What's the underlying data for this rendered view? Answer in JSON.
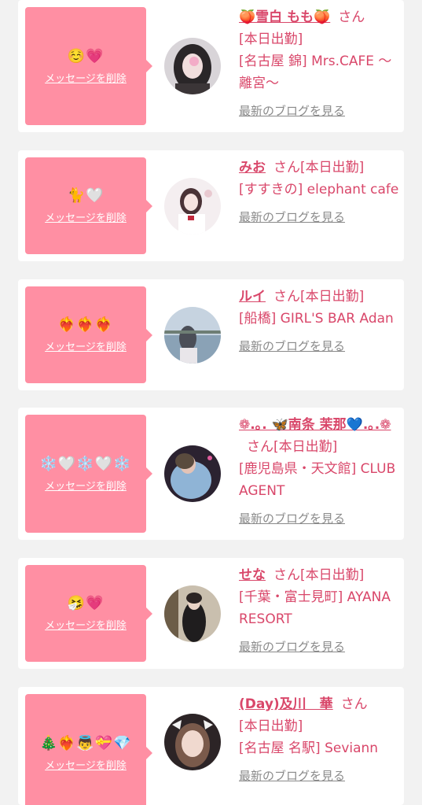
{
  "delete_label": "メッセージを削除",
  "blog_label": "最新のブログを見る",
  "san_label": "さん",
  "colors": {
    "accent": "#d9476a",
    "bubble": "#ff8fa3",
    "background": "#f2f2f2"
  },
  "cards": [
    {
      "emoji": "☺️💗",
      "name": "🍑雪白 もも🍑",
      "status": "[本日出勤]",
      "shop": "[名古屋 錦] Mrs.CAFE 〜離宮〜",
      "avatar_icon": "avatar-photo"
    },
    {
      "emoji": "🐈🤍",
      "name": "みお",
      "status": "[本日出勤]",
      "shop": "[すすきの] elephant cafe",
      "avatar_icon": "avatar-photo"
    },
    {
      "emoji": "❤️‍🔥❤️‍🔥❤️‍🔥",
      "name": "ルイ",
      "status": "[本日出勤]",
      "shop": "[船橋] GIRL'S BAR Adan",
      "avatar_icon": "avatar-photo"
    },
    {
      "emoji": "❄️🤍❄️🤍❄️",
      "name": "❁.｡. 🦋南条 茉那💙.｡.❁",
      "status": "[本日出勤]",
      "shop": "[鹿児島県・天文館] CLUB AGENT",
      "avatar_icon": "avatar-photo"
    },
    {
      "emoji": "🤧💗",
      "name": "せな",
      "status": "[本日出勤]",
      "shop": "[千葉・富士見町] AYANA RESORT",
      "avatar_icon": "avatar-photo"
    },
    {
      "emoji": "🎄❤️‍🔥👼💝💎",
      "name": "(Day)及川　華",
      "status": "[本日出勤]",
      "shop": "[名古屋 名駅] Seviann",
      "avatar_icon": "avatar-photo"
    }
  ]
}
